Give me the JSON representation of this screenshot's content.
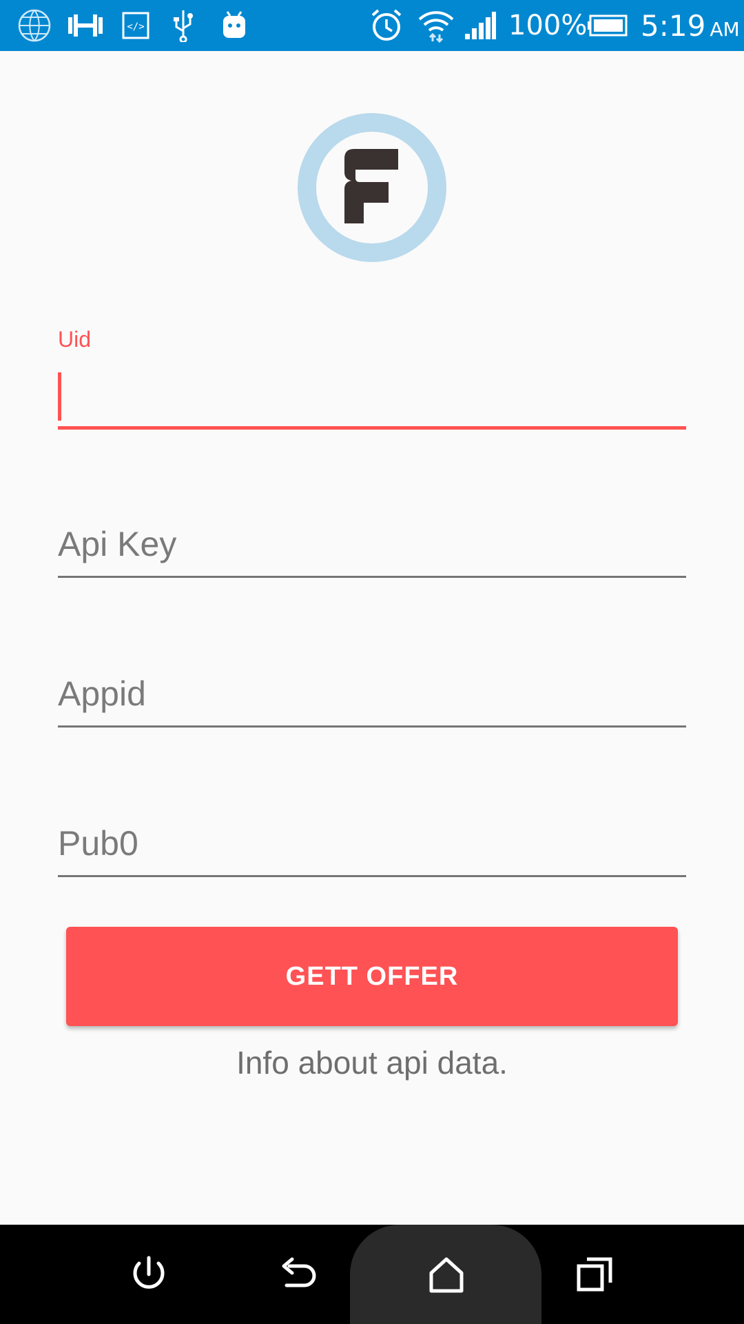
{
  "status_bar": {
    "battery_percent": "100%",
    "time": "5:19",
    "ampm": "AM",
    "background": "#0288d1",
    "icons": [
      "globe-icon",
      "dumbbell-icon",
      "code-icon",
      "usb-icon",
      "android-icon",
      "alarm-icon",
      "wifi-icon",
      "signal-icon",
      "battery-icon"
    ]
  },
  "logo": {
    "icon": "f-logo-icon",
    "ring_color": "#b9d9ec"
  },
  "form": {
    "uid_label": "Uid",
    "uid_value": "",
    "api_key_hint": "Api Key",
    "appid_hint": "Appid",
    "pub0_hint": "Pub0",
    "accent": "#ff5252"
  },
  "button": {
    "label": "GETT OFFER",
    "color": "#ff5254"
  },
  "info": {
    "text": "Info about api data."
  },
  "nav_bar": {
    "icons": [
      "power-icon",
      "back-icon",
      "home-icon",
      "recents-icon"
    ]
  }
}
